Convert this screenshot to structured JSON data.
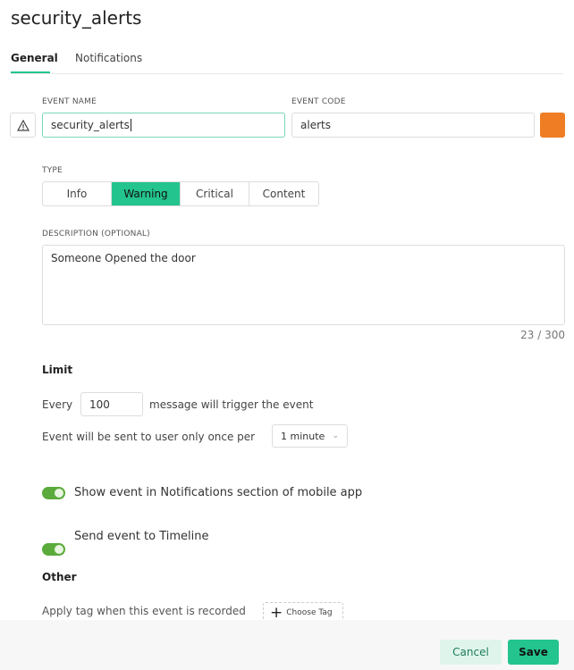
{
  "title": "security_alerts",
  "tabs": [
    "General",
    "Notifications"
  ],
  "event_name": {
    "label": "EVENT NAME",
    "value": "security_alerts"
  },
  "event_code": {
    "label": "EVENT CODE",
    "value": "alerts"
  },
  "color": "#ee7d23",
  "icon": "warning-icon",
  "type": {
    "label": "TYPE",
    "options": [
      "Info",
      "Warning",
      "Critical",
      "Content"
    ],
    "selected": "Warning"
  },
  "description": {
    "label": "DESCRIPTION (OPTIONAL)",
    "value": "Someone Opened the door",
    "counter": "23 / 300"
  },
  "limit": {
    "heading": "Limit",
    "every": "Every",
    "count": "100",
    "suffix": "message will trigger the event",
    "once_label": "Event will be sent to user only once per",
    "period": "1 minute"
  },
  "toggles": [
    {
      "label": "Show event in Notifications section of mobile app",
      "on": true
    },
    {
      "label": "Send event to Timeline",
      "on": true
    }
  ],
  "other": {
    "heading": "Other",
    "tag_label": "Apply tag when this event is recorded",
    "choose_tag": "Choose Tag"
  },
  "footer": {
    "cancel": "Cancel",
    "save": "Save"
  }
}
